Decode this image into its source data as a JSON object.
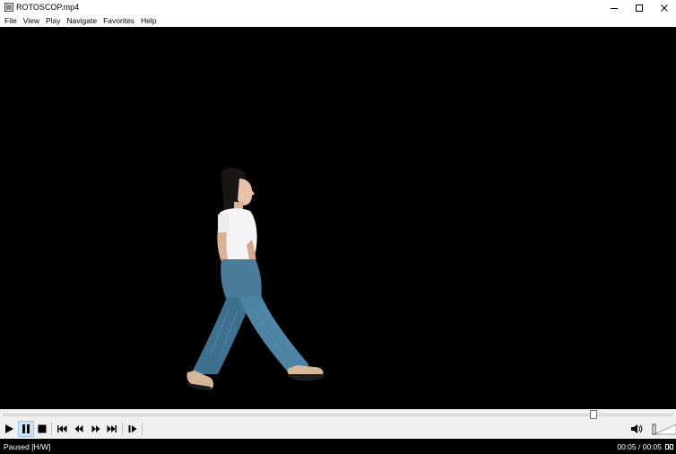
{
  "window": {
    "title": "ROTOSCOP.mp4",
    "icon": "film-icon",
    "controls": [
      "minimize-icon",
      "maximize-icon",
      "close-icon"
    ]
  },
  "menu": [
    {
      "label": "File"
    },
    {
      "label": "View"
    },
    {
      "label": "Play"
    },
    {
      "label": "Navigate"
    },
    {
      "label": "Favorites"
    },
    {
      "label": "Help"
    }
  ],
  "player": {
    "video_background": "#000000",
    "seek_progress": 0.88,
    "buttons": [
      "play-icon",
      "pause-icon",
      "stop-icon",
      "previous-icon",
      "rewind-icon",
      "fast-forward-icon",
      "next-icon",
      "frame-step-icon"
    ],
    "active_button": "pause",
    "volume_icon": "speaker-icon",
    "volume_level": 0.05
  },
  "status": {
    "state": "Paused [H/W]",
    "time": "00:05 / 00:05",
    "icon": "connection-icon"
  },
  "colors": {
    "video": "#000000",
    "toolbar": "#f0f0f0",
    "active_button": "#cfe4f7"
  }
}
